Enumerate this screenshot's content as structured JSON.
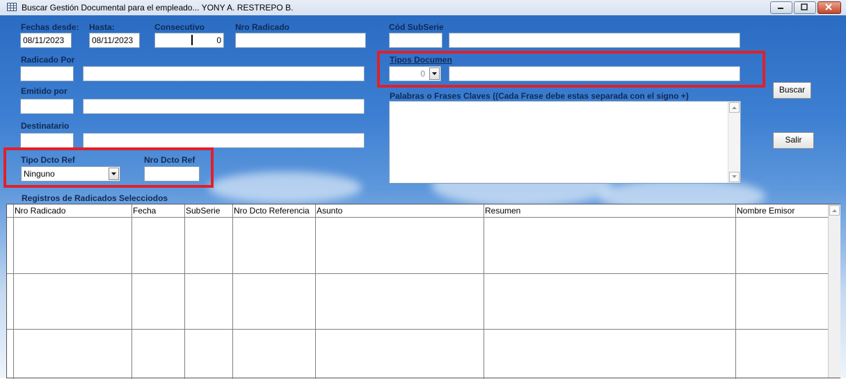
{
  "window": {
    "title": "Buscar Gestión Documental para el empleado... YONY A. RESTREPO B.",
    "controls": {
      "minimize": "▭",
      "maximize": "▢",
      "close": "✕"
    }
  },
  "form": {
    "fechas_desde": {
      "label": "Fechas desde:",
      "value": "08/11/2023"
    },
    "hasta": {
      "label": "Hasta:",
      "value": "08/11/2023"
    },
    "consecutivo": {
      "label": "Consecutivo",
      "value": "0"
    },
    "nro_radicado": {
      "label": "Nro Radicado",
      "value": ""
    },
    "cod_subserie": {
      "label": "Cód SubSerie",
      "code": "",
      "name": ""
    },
    "radicado_por": {
      "label": "Radicado Por",
      "code": "",
      "name": ""
    },
    "tipos_documen": {
      "label": "Tipos Documen",
      "code": "0",
      "name": ""
    },
    "emitido_por": {
      "label": "Emitido por",
      "code": "",
      "name": ""
    },
    "palabras": {
      "label": "Palabras o Frases Claves ((Cada Frase debe estas separada con el signo +)",
      "value": ""
    },
    "destinatario": {
      "label": "Destinatario",
      "code": "",
      "name": ""
    },
    "tipo_dcto_ref": {
      "label": "Tipo Dcto Ref",
      "value": "Ninguno"
    },
    "nro_dcto_ref": {
      "label": "Nro Dcto Ref",
      "value": ""
    },
    "buscar": "Buscar",
    "salir": "Salir",
    "registros_label": "Registros de Radicados Selecciodos"
  },
  "grid": {
    "columns": [
      "Nro Radicado",
      "Fecha",
      "SubSerie",
      "Nro Dcto Referencia",
      "Asunto",
      "Resumen",
      "Nombre Emisor"
    ],
    "rows": []
  },
  "colors": {
    "highlight": "#e0202a",
    "label": "#102a55",
    "sky_top": "#2b6cc3"
  }
}
